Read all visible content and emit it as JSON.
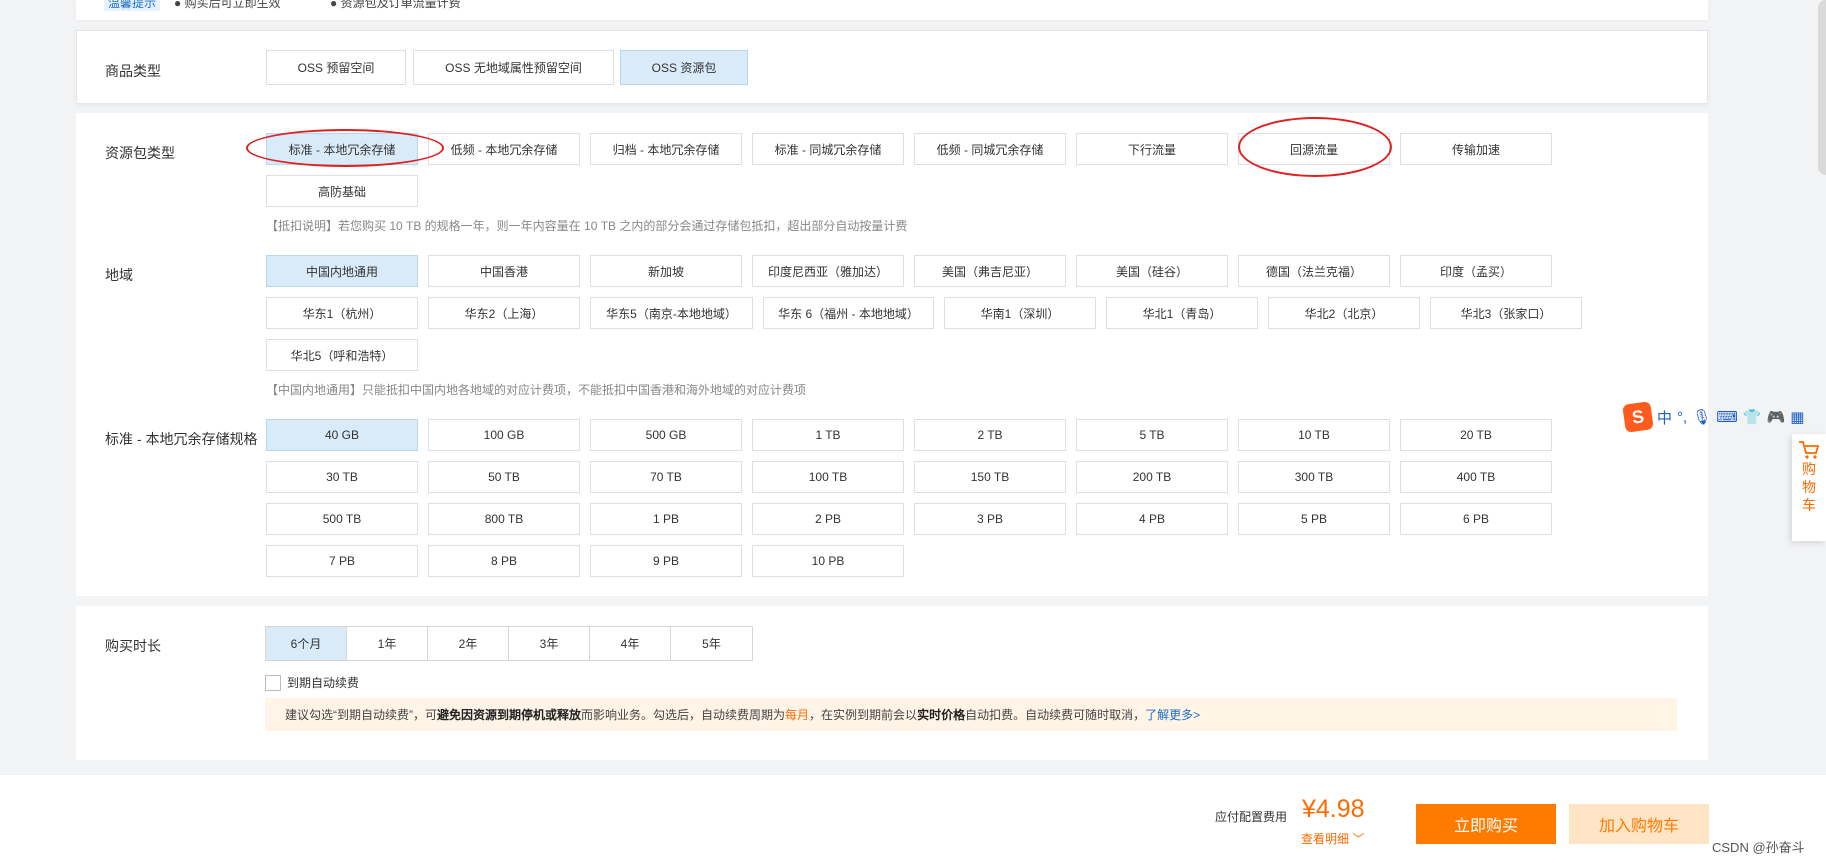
{
  "top_bar": {
    "tag": "温馨提示",
    "tip1": "购买后可立即生效",
    "tip2": "资源包及订单流量计费"
  },
  "product": {
    "label": "商品类型",
    "options": [
      "OSS 预留空间",
      "OSS 无地域属性预留空间",
      "OSS 资源包"
    ],
    "selected": "OSS 资源包"
  },
  "package_type": {
    "label": "资源包类型",
    "options": [
      "标准 - 本地冗余存储",
      "低频 - 本地冗余存储",
      "归档 - 本地冗余存储",
      "标准 - 同城冗余存储",
      "低频 - 同城冗余存储",
      "下行流量",
      "回源流量",
      "传输加速",
      "高防基础"
    ],
    "selected": "标准 - 本地冗余存储",
    "note": "【抵扣说明】若您购买 10 TB 的规格一年，则一年内容量在 10 TB 之内的部分会通过存储包抵扣，超出部分自动按量计费"
  },
  "region": {
    "label": "地域",
    "options": [
      "中国内地通用",
      "中国香港",
      "新加坡",
      "印度尼西亚（雅加达）",
      "美国（弗吉尼亚）",
      "美国（硅谷）",
      "德国（法兰克福）",
      "印度（孟买）",
      "华东1（杭州）",
      "华东2（上海）",
      "华东5（南京-本地地域）",
      "华东 6（福州 - 本地地域）",
      "华南1（深圳）",
      "华北1（青岛）",
      "华北2（北京）",
      "华北3（张家口）",
      "华北5（呼和浩特）"
    ],
    "selected": "中国内地通用",
    "note": "【中国内地通用】只能抵扣中国内地各地域的对应计费项，不能抵扣中国香港和海外地域的对应计费项"
  },
  "spec": {
    "label": "标准 - 本地冗余存储规格",
    "options": [
      "40 GB",
      "100 GB",
      "500 GB",
      "1 TB",
      "2 TB",
      "5 TB",
      "10 TB",
      "20 TB",
      "30 TB",
      "50 TB",
      "70 TB",
      "100 TB",
      "150 TB",
      "200 TB",
      "300 TB",
      "400 TB",
      "500 TB",
      "800 TB",
      "1 PB",
      "2 PB",
      "3 PB",
      "4 PB",
      "5 PB",
      "6 PB",
      "7 PB",
      "8 PB",
      "9 PB",
      "10 PB"
    ],
    "selected": "40 GB"
  },
  "duration": {
    "label": "购买时长",
    "options": [
      "6个月",
      "1年",
      "2年",
      "3年",
      "4年",
      "5年"
    ],
    "selected": "6个月",
    "auto_renew_label": "到期自动续费",
    "tip": {
      "p1": "建议勾选“到期自动续费”，可",
      "b1": "避免因资源到期停机或释放",
      "p2": "而影响业务。勾选后，自动续费周期为 ",
      "o1": "每月",
      "p3": "，在实例到期前会以",
      "b2": "实时价格",
      "p4": "自动扣费。自动续费可随时取消，",
      "link": "了解更多>"
    }
  },
  "footer": {
    "fee_label": "应付配置费用",
    "price": "¥4.98",
    "detail": "查看明细",
    "buy_now": "立即购买",
    "add_cart": "加入购物车",
    "watermark": "CSDN @孙奋斗"
  },
  "side_cart": {
    "chars": [
      "购",
      "物",
      "车"
    ]
  },
  "ime_bar": {
    "logo": "S",
    "lang": "中"
  },
  "colors": {
    "accent": "#ff6a00",
    "selected_bg": "#d9ebf9",
    "annotation": "#e02020"
  }
}
